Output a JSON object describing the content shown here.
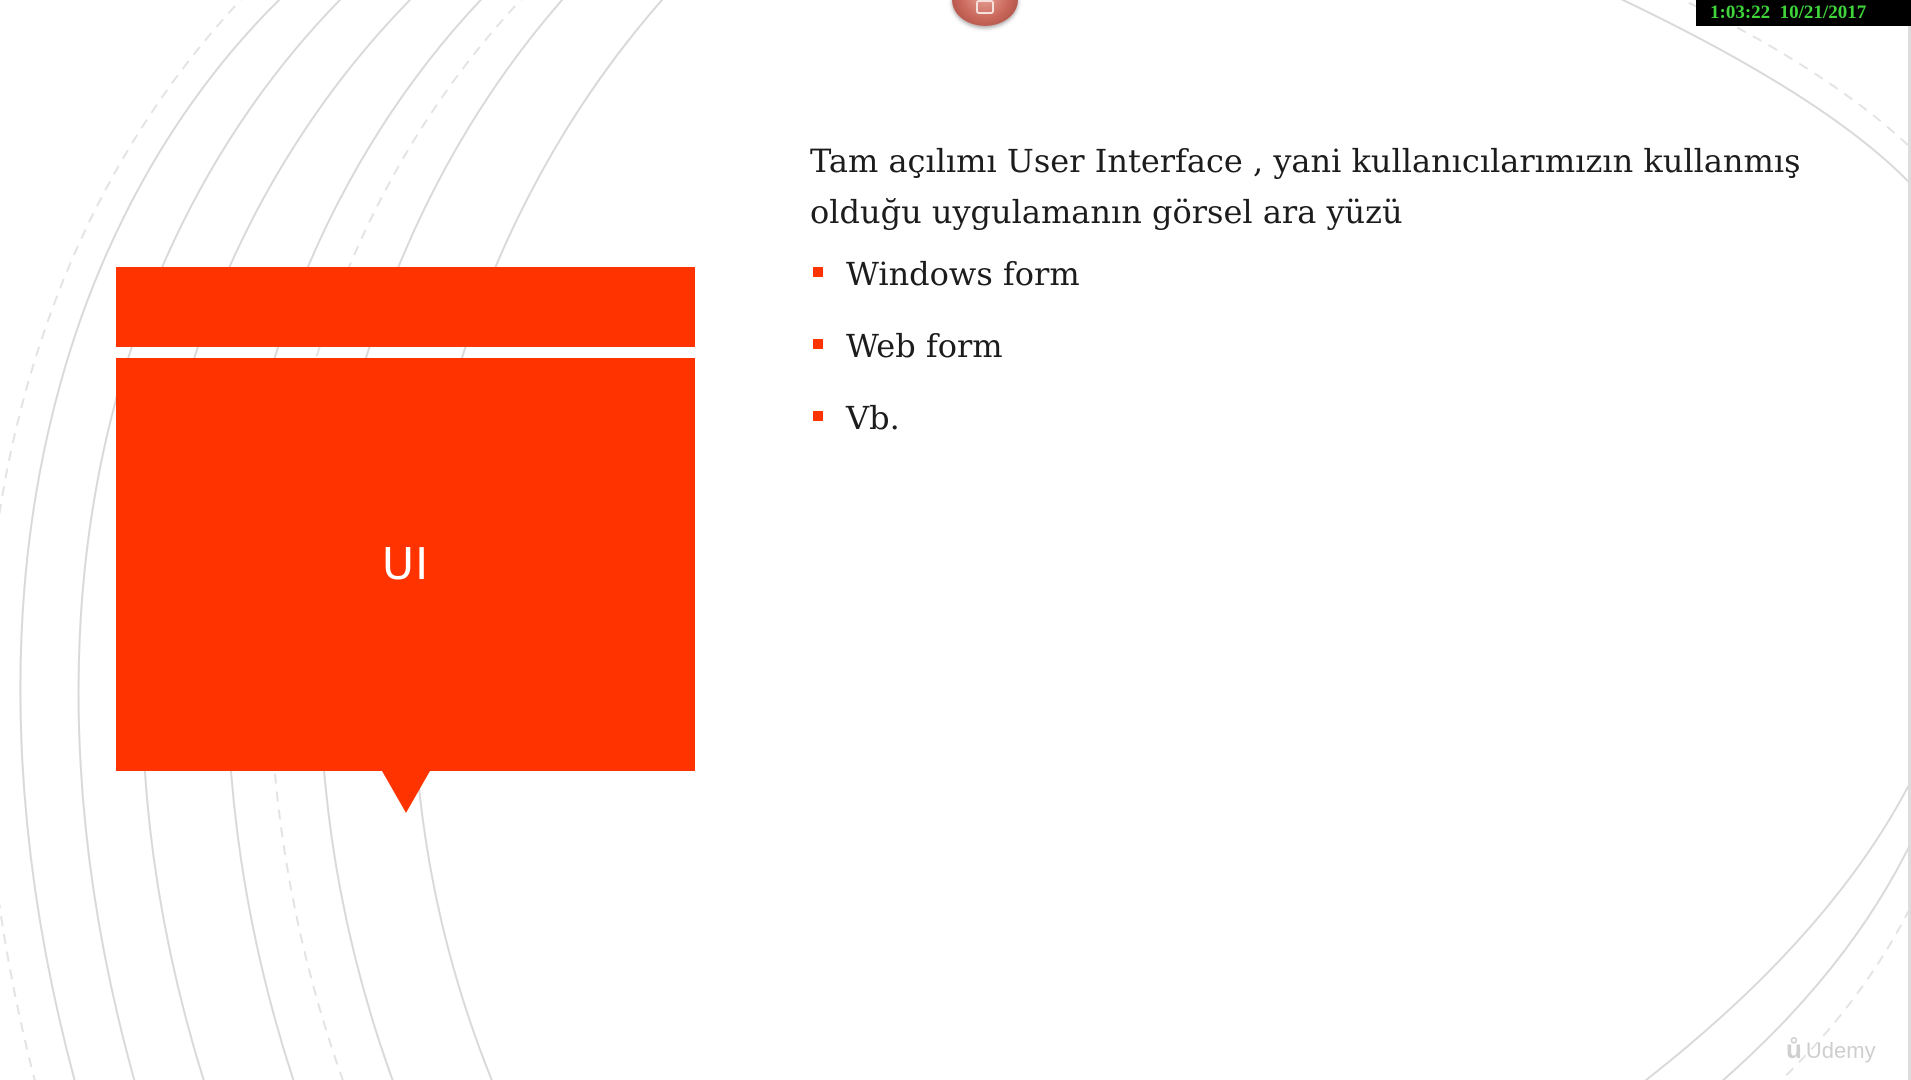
{
  "recording_overlay": {
    "time": "1:03:22",
    "date": "10/21/2017"
  },
  "slide": {
    "title": "UI",
    "intro": "Tam açılımı User Interface , yani kullanıcılarımızın kullanmış olduğu uygulamanın görsel ara yüzü",
    "bullets": [
      {
        "label": "Windows form"
      },
      {
        "label": "Web form"
      },
      {
        "label": "Vb."
      }
    ],
    "accent_color": "#ff3300"
  },
  "watermark": {
    "text": "Udemy",
    "icon": "udemy-logo-icon"
  },
  "icons": {
    "camera": "camera-icon"
  }
}
